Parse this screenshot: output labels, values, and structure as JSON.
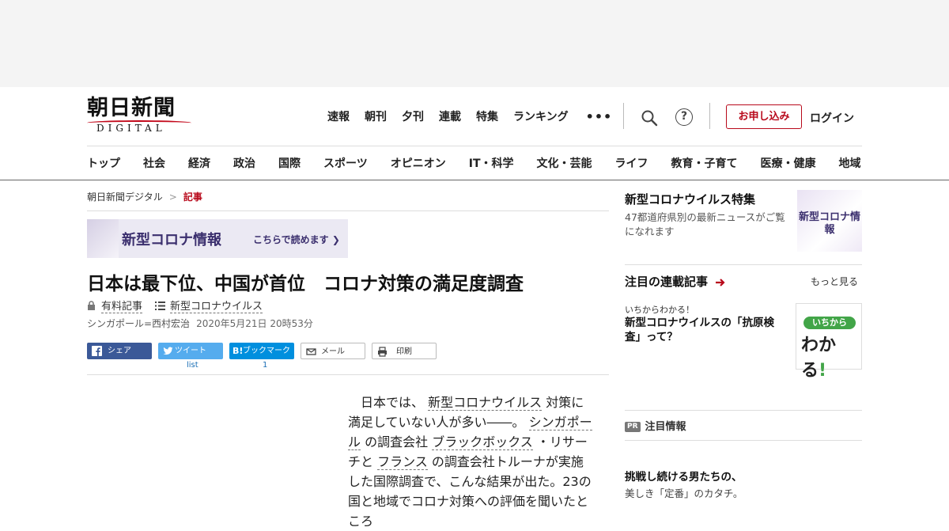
{
  "logo": {
    "kanji": "朝日新聞",
    "digital": "DIGITAL"
  },
  "topnav": [
    "速報",
    "朝刊",
    "夕刊",
    "連載",
    "特集",
    "ランキング"
  ],
  "topnav_more": "•••",
  "header_actions": {
    "help": "?",
    "apply": "お申し込み",
    "login": "ログイン"
  },
  "secnav": [
    "トップ",
    "社会",
    "経済",
    "政治",
    "国際",
    "スポーツ",
    "オピニオン",
    "IT・科学",
    "文化・芸能",
    "ライフ",
    "教育・子育て",
    "医療・健康",
    "地域"
  ],
  "breadcrumb": {
    "home": "朝日新聞デジタル",
    "sep": ">",
    "current": "記事"
  },
  "banner": {
    "title": "新型コロナ情報",
    "link": "こちらで読めます"
  },
  "article": {
    "title": "日本は最下位、中国が首位　コロナ対策の満足度調査",
    "paid": "有料記事",
    "topic": "新型コロナウイルス",
    "author": "シンガポール=西村宏治",
    "date": "2020年5月21日 20時53分"
  },
  "share": {
    "facebook": "シェア",
    "twitter": "ツイート",
    "hatena": "ブックマーク",
    "hatena_mark": "B!",
    "mail": "メール",
    "print": "印刷",
    "twitter_count": "list",
    "hatena_count": "1"
  },
  "body": {
    "p1": "日本では、",
    "l1": "新型コロナウイルス",
    "p2": "対策に満足していない人が多い――。",
    "l2": "シンガポール",
    "p3": "の調査会社",
    "l3": "ブラックボックス",
    "p4": "・リサーチと",
    "l4": "フランス",
    "p5": "の調査会社トルーナが実施した国際調査で、こんな結果が出た。23の国と地域でコロナ対策への評価を聞いたところ"
  },
  "sidebar": {
    "corona_title": "新型コロナウイルス特集",
    "corona_desc": "47都道府県別の最新ニュースがご覧になれます",
    "corona_thumb": "新型コロナ情報",
    "series_title": "注目の連載記事",
    "series_more": "もっと見る",
    "series_kicker": "いちからわかる！",
    "series_headline": "新型コロナウイルスの「抗原検査」って？",
    "wakaru_pill": "いちから",
    "wakaru_big": "わかる",
    "wakaru_ex": "!",
    "pr_badge": "PR",
    "pr_title": "注目情報",
    "promo_title": "挑戦し続ける男たちの、",
    "promo_sub": "美しき「定番」のカタチ。"
  },
  "colors": {
    "brand_red": "#b8091b",
    "facebook": "#3b5998",
    "twitter": "#55acee",
    "hatena": "#008fde",
    "banner_purple": "#3b2f6e"
  }
}
